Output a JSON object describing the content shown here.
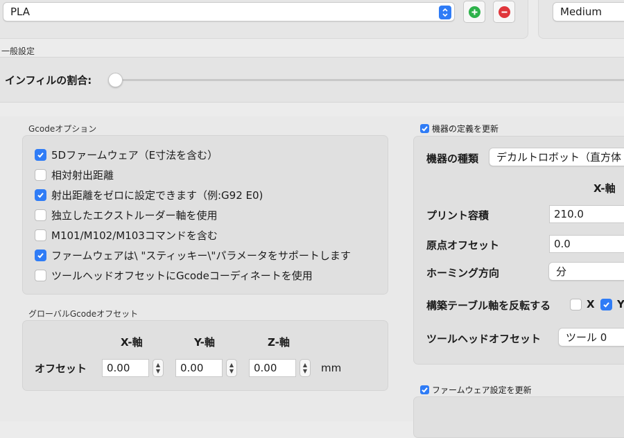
{
  "top": {
    "material_value": "PLA",
    "quality_value": "Medium"
  },
  "general": {
    "section_title": "一般設定",
    "infill_label": "インフィルの割合:",
    "infill_fraction": 0.0
  },
  "gcode_options": {
    "section_title": "Gcodeオプション",
    "items": [
      {
        "label": "5Dファームウェア（E寸法を含む）",
        "checked": true
      },
      {
        "label": "相対射出距離",
        "checked": false
      },
      {
        "label": "射出距離をゼロに設定できます（例:G92 E0)",
        "checked": true
      },
      {
        "label": "独立したエクストルーダー軸を使用",
        "checked": false
      },
      {
        "label": "M101/M102/M103コマンドを含む",
        "checked": false
      },
      {
        "label": "ファームウェアは\\ \"スティッキー\\\"パラメータをサポートします",
        "checked": true
      },
      {
        "label": "ツールヘッドオフセットにGcodeコーディネートを使用",
        "checked": false
      }
    ]
  },
  "global_offset": {
    "section_title": "グローバルGcodeオフセット",
    "col_x": "X-軸",
    "col_y": "Y-軸",
    "col_z": "Z-軸",
    "row_label": "オフセット",
    "x_value": "0.00",
    "y_value": "0.00",
    "z_value": "0.00",
    "unit": "mm"
  },
  "machine": {
    "update_label": "機器の定義を更新",
    "update_checked": true,
    "type_label": "機器の種類",
    "type_value": "デカルトロボット（直方体",
    "axis_header": "X-軸",
    "print_volume_label": "プリント容積",
    "print_volume_value": "210.0",
    "origin_offset_label": "原点オフセット",
    "origin_offset_value": "0.0",
    "homing_label": "ホーミング方向",
    "homing_value": "分",
    "invert_label": "構築テーブル軸を反転する",
    "invert_x_label": "X",
    "invert_x_checked": false,
    "invert_y_label": "Y",
    "invert_y_checked": true,
    "toolhead_offset_label": "ツールヘッドオフセット",
    "toolhead_offset_value": "ツール 0"
  },
  "firmware": {
    "update_label": "ファームウェア設定を更新",
    "update_checked": true
  },
  "colors": {
    "accent": "#2f7cf6",
    "add_green": "#2db24a",
    "remove_red": "#e0363b"
  }
}
